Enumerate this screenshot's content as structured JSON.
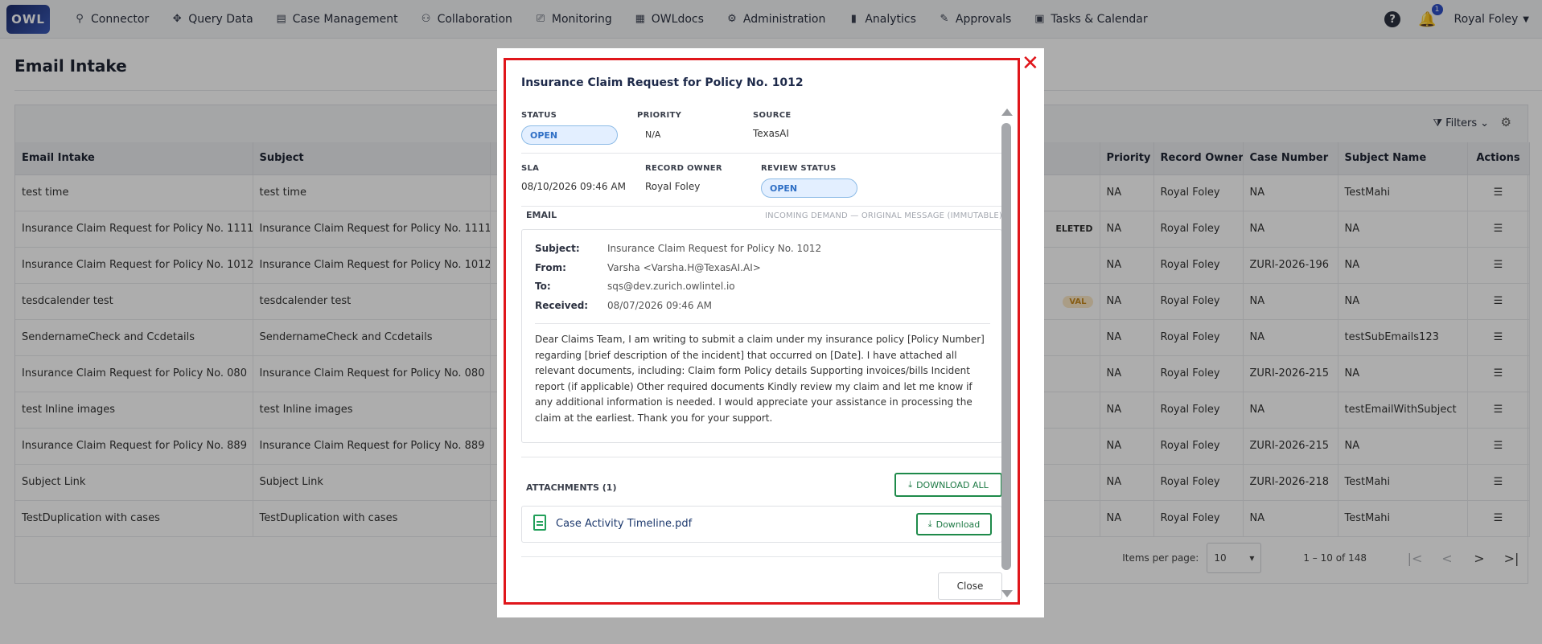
{
  "app": {
    "logo_text": "OWL",
    "nav": [
      {
        "label": "Connector",
        "icon": "search-icon",
        "glyph": "⚲"
      },
      {
        "label": "Query Data",
        "icon": "move-icon",
        "glyph": "✥"
      },
      {
        "label": "Case Management",
        "icon": "case-icon",
        "glyph": "▤"
      },
      {
        "label": "Collaboration",
        "icon": "users-icon",
        "glyph": "⚇"
      },
      {
        "label": "Monitoring",
        "icon": "monitor-icon",
        "glyph": "⎚"
      },
      {
        "label": "OWLdocs",
        "icon": "docs-icon",
        "glyph": "▦"
      },
      {
        "label": "Administration",
        "icon": "admin-icon",
        "glyph": "⚙"
      },
      {
        "label": "Analytics",
        "icon": "analytics-icon",
        "glyph": "▮"
      },
      {
        "label": "Approvals",
        "icon": "approvals-icon",
        "glyph": "✎"
      },
      {
        "label": "Tasks & Calendar",
        "icon": "calendar-icon",
        "glyph": "▣"
      }
    ],
    "help_glyph": "?",
    "notification_count": "1",
    "user_name": "Royal Foley"
  },
  "page": {
    "title": "Email Intake",
    "filters_label": "Filters"
  },
  "table": {
    "columns": [
      "Email Intake",
      "Subject",
      "",
      "Priority",
      "Record Owner",
      "Case Number",
      "Subject Name",
      "Actions"
    ],
    "rows": [
      {
        "intake": "test time",
        "subject": "test time",
        "status": "",
        "priority": "NA",
        "owner": "Royal Foley",
        "case": "NA",
        "subject_name": "TestMahi"
      },
      {
        "intake": "Insurance Claim Request for Policy No. 1111",
        "subject": "Insurance Claim Request for Policy No. 1111",
        "status": "ELETED",
        "priority": "NA",
        "owner": "Royal Foley",
        "case": "NA",
        "subject_name": "NA"
      },
      {
        "intake": "Insurance Claim Request for Policy No. 1012",
        "subject": "Insurance Claim Request for Policy No. 1012",
        "status": "",
        "priority": "NA",
        "owner": "Royal Foley",
        "case": "ZURI-2026-196",
        "subject_name": "NA"
      },
      {
        "intake": "tesdcalender test",
        "subject": "tesdcalender test",
        "status": "VAL",
        "priority": "NA",
        "owner": "Royal Foley",
        "case": "NA",
        "subject_name": "NA"
      },
      {
        "intake": "SendernameCheck and Ccdetails",
        "subject": "SendernameCheck and Ccdetails",
        "status": "",
        "priority": "NA",
        "owner": "Royal Foley",
        "case": "NA",
        "subject_name": "testSubEmails123"
      },
      {
        "intake": "Insurance Claim Request for Policy No. 080",
        "subject": "Insurance Claim Request for Policy No. 080",
        "status": "",
        "priority": "NA",
        "owner": "Royal Foley",
        "case": "ZURI-2026-215",
        "subject_name": "NA"
      },
      {
        "intake": "test Inline images",
        "subject": "test Inline images",
        "status": "",
        "priority": "NA",
        "owner": "Royal Foley",
        "case": "NA",
        "subject_name": "testEmailWithSubject"
      },
      {
        "intake": "Insurance Claim Request for Policy No. 889",
        "subject": "Insurance Claim Request for Policy No. 889",
        "status": "",
        "priority": "NA",
        "owner": "Royal Foley",
        "case": "ZURI-2026-215",
        "subject_name": "NA"
      },
      {
        "intake": "Subject Link",
        "subject": "Subject Link",
        "status": "",
        "priority": "NA",
        "owner": "Royal Foley",
        "case": "ZURI-2026-218",
        "subject_name": "TestMahi"
      },
      {
        "intake": "TestDuplication with cases",
        "subject": "TestDuplication with cases",
        "status": "",
        "priority": "NA",
        "owner": "Royal Foley",
        "case": "NA",
        "subject_name": "TestMahi"
      }
    ],
    "pager": {
      "items_label": "Items per page:",
      "items_value": "10",
      "range": "1 – 10 of 148"
    }
  },
  "modal": {
    "title": "Insurance Claim Request for Policy No. 1012",
    "status_label": "STATUS",
    "status_value": "OPEN",
    "priority_label": "PRIORITY",
    "priority_value": "N/A",
    "source_label": "SOURCE",
    "source_value": "TexasAI",
    "sla_label": "SLA",
    "sla_value": "08/10/2026 09:46 AM",
    "owner_label": "RECORD OWNER",
    "owner_value": "Royal Foley",
    "review_label": "REVIEW STATUS",
    "review_value": "OPEN",
    "email_label": "EMAIL",
    "email_note": "INCOMING DEMAND — ORIGINAL MESSAGE (IMMUTABLE)",
    "email": {
      "subject_k": "Subject:",
      "subject_v": "Insurance Claim Request for Policy No. 1012",
      "from_k": "From:",
      "from_v": "Varsha <Varsha.H@TexasAI.AI>",
      "to_k": "To:",
      "to_v": "sqs@dev.zurich.owlintel.io",
      "received_k": "Received:",
      "received_v": "08/07/2026 09:46 AM",
      "body": "Dear Claims Team, I am writing to submit a claim under my insurance policy [Policy Number] regarding [brief description of the incident] that occurred on [Date]. I have attached all relevant documents, including: Claim form Policy details Supporting invoices/bills Incident report (if applicable) Other required documents Kindly review my claim and let me know if any additional information is needed. I would appreciate your assistance in processing the claim at the earliest. Thank you for your support."
    },
    "attachments_label": "ATTACHMENTS (1)",
    "download_all_label": "DOWNLOAD ALL",
    "attachment_name": "Case Activity Timeline.pdf",
    "download_label": "Download",
    "close_label": "Close"
  },
  "colors": {
    "modal_border": "#e0161b",
    "status_pill": "#e3efff",
    "download_green": "#1e8a4a"
  }
}
